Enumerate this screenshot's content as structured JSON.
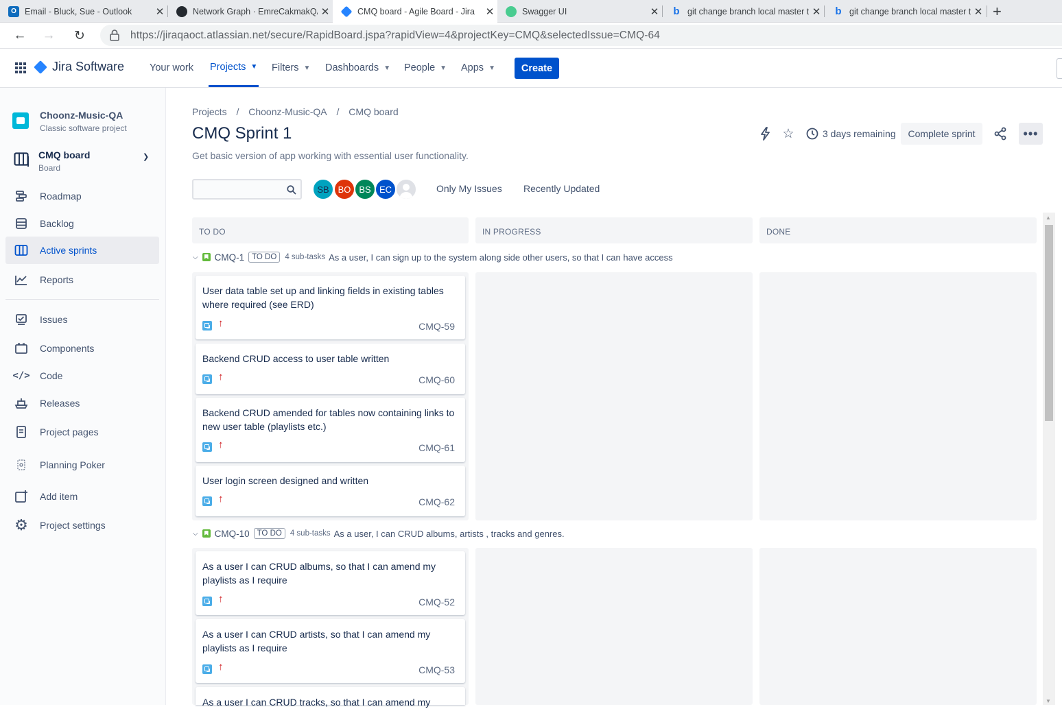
{
  "browser": {
    "tabs": [
      {
        "title": "Email - Bluck, Sue - Outlook",
        "icon": "outlook-icon",
        "color": "#0f6cbd"
      },
      {
        "title": "Network Graph · EmreCakmakQA",
        "icon": "github-icon",
        "color": "#24292f"
      },
      {
        "title": "CMQ board - Agile Board - Jira",
        "icon": "jira-icon",
        "color": "#2684ff"
      },
      {
        "title": "Swagger UI",
        "icon": "swagger-icon",
        "color": "#49cc90"
      },
      {
        "title": "git change branch local master t",
        "icon": "bing-icon",
        "color": "#1a73e8"
      },
      {
        "title": "git change branch local master t",
        "icon": "bing-icon",
        "color": "#1a73e8"
      }
    ],
    "url": "https://jiraqaoct.atlassian.net/secure/RapidBoard.jspa?rapidView=4&projectKey=CMQ&selectedIssue=CMQ-64"
  },
  "header": {
    "product": "Jira Software",
    "nav": [
      "Your work",
      "Projects",
      "Filters",
      "Dashboards",
      "People",
      "Apps"
    ],
    "create": "Create"
  },
  "sidebar": {
    "project_name": "Choonz-Music-QA",
    "project_type": "Classic software project",
    "board_name": "CMQ board",
    "board_type": "Board",
    "items": [
      {
        "label": "Roadmap",
        "icon": "roadmap-icon"
      },
      {
        "label": "Backlog",
        "icon": "backlog-icon"
      },
      {
        "label": "Active sprints",
        "icon": "board-icon"
      },
      {
        "label": "Reports",
        "icon": "reports-icon"
      },
      {
        "label": "Issues",
        "icon": "issues-icon"
      },
      {
        "label": "Components",
        "icon": "components-icon"
      },
      {
        "label": "Code",
        "icon": "code-icon"
      },
      {
        "label": "Releases",
        "icon": "releases-icon"
      },
      {
        "label": "Project pages",
        "icon": "pages-icon"
      },
      {
        "label": "Planning Poker",
        "icon": "poker-icon"
      },
      {
        "label": "Add item",
        "icon": "add-item-icon"
      },
      {
        "label": "Project settings",
        "icon": "settings-icon"
      }
    ]
  },
  "main": {
    "breadcrumbs": [
      "Projects",
      "/",
      "Choonz-Music-QA",
      "/",
      "CMQ board"
    ],
    "sprint_title": "CMQ Sprint 1",
    "sprint_goal": "Get basic version of app working with essential user functionality.",
    "days_remaining": "3 days remaining",
    "complete_sprint": "Complete sprint",
    "more": "•••",
    "avatars": [
      {
        "initials": "SB",
        "color": "#00a3bf"
      },
      {
        "initials": "BO",
        "color": "#de350b"
      },
      {
        "initials": "BS",
        "color": "#00875a"
      },
      {
        "initials": "EC",
        "color": "#0052cc"
      },
      {
        "initials": "",
        "color": "#dfe1e6"
      }
    ],
    "quick_filters": [
      "Only My Issues",
      "Recently Updated"
    ],
    "columns": [
      "TO DO",
      "IN PROGRESS",
      "DONE"
    ],
    "swimlanes": [
      {
        "key": "CMQ-1",
        "status": "TO DO",
        "subtasks": "4 sub-tasks",
        "summary": "As a user, I can sign up to the system along side other users, so that I can have access",
        "cards": [
          {
            "title": "User data table set up and linking fields in existing tables where required (see ERD)",
            "key": "CMQ-59"
          },
          {
            "title": "Backend CRUD access to user table written",
            "key": "CMQ-60"
          },
          {
            "title": "Backend CRUD amended for tables now containing links to new user table (playlists etc.)",
            "key": "CMQ-61"
          },
          {
            "title": "User login screen designed and written",
            "key": "CMQ-62"
          }
        ]
      },
      {
        "key": "CMQ-10",
        "status": "TO DO",
        "subtasks": "4 sub-tasks",
        "summary": "As a user, I can CRUD albums, artists , tracks and genres.",
        "cards": [
          {
            "title": "As a user I can CRUD albums, so that I can amend my playlists as I require",
            "key": "CMQ-52"
          },
          {
            "title": "As a user I can CRUD artists, so that I can amend my playlists as I require",
            "key": "CMQ-53"
          },
          {
            "title": "As a user I can CRUD tracks, so that I can amend my",
            "key": ""
          }
        ]
      }
    ]
  }
}
